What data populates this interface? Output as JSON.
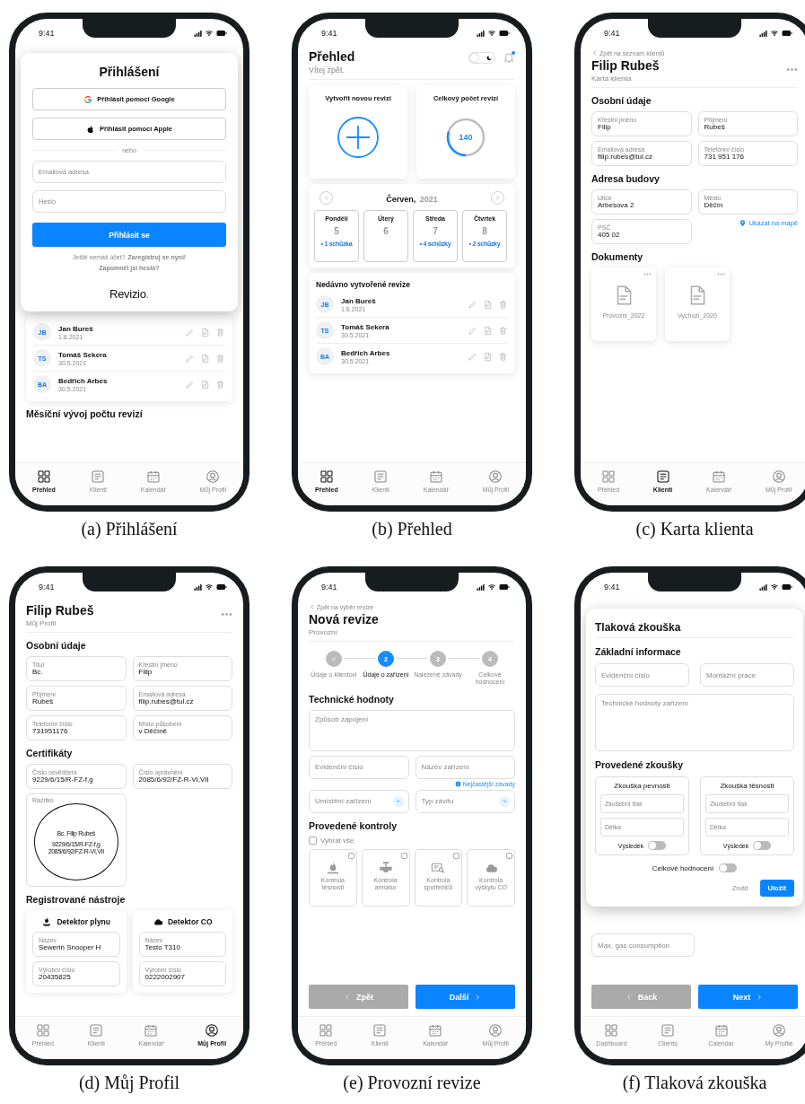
{
  "figures": [
    {
      "caption": "(a) Přihlášení",
      "time": "9:41",
      "screen": {
        "kind": "login",
        "background": {
          "rows": [
            {
              "initials": "JB",
              "name": "Jan Bureš",
              "date": "1.6.2021"
            },
            {
              "initials": "TS",
              "name": "Tomáš Sekera",
              "date": "30.5.2021"
            },
            {
              "initials": "BA",
              "name": "Bedřich Arbes",
              "date": "30.5.2021"
            }
          ],
          "heading": "Měsíční vývoj počtu revizí",
          "nav": [
            {
              "kind": "dashboard",
              "label": "Přehled",
              "selected": true
            },
            {
              "kind": "clients",
              "label": "Klienti",
              "selected": false
            },
            {
              "kind": "calendar",
              "label": "Kalendář",
              "selected": false
            },
            {
              "kind": "profile",
              "label": "Můj Profil",
              "selected": false
            }
          ]
        },
        "title": "Přihlášení",
        "providers": [
          {
            "kind": "google",
            "label": "Přihlásit pomocí Google"
          },
          {
            "kind": "apple",
            "label": "Přihlásit pomocí Apple"
          }
        ],
        "divider": "nebo",
        "fields": [
          {
            "placeholder": "Emailová adresa"
          },
          {
            "placeholder": "Heslo"
          }
        ],
        "submit": "Přihlásit se",
        "register_prompt": "Ještě nemáš účet?",
        "register_link": "Zaregistruj se nyní!",
        "forgot": "Zapomněl jsi heslo?",
        "logo": {
          "name": "Revizio",
          "dot": "."
        }
      }
    },
    {
      "caption": "(b) Přehled",
      "time": "9:41",
      "screen": {
        "kind": "dashboard",
        "title": "Přehled",
        "subtitle": "Vítej zpět.",
        "dark_mode": false,
        "notification": true,
        "cards": [
          {
            "kind": "create",
            "title": "Vytvořit novou revizi"
          },
          {
            "kind": "total",
            "title": "Celkový počet revizí",
            "value": "140",
            "level": 0.3
          }
        ],
        "calendar": {
          "month": "Červen,",
          "year": "2021",
          "days": [
            {
              "name": "Pondělí",
              "number": "5",
              "meetings": "• 1 schůzka"
            },
            {
              "name": "Úterý",
              "number": "6"
            },
            {
              "name": "Středa",
              "number": "7",
              "meetings": "• 4 schůzky"
            },
            {
              "name": "Čtvrtek",
              "number": "8",
              "meetings": "• 2 schůzky"
            }
          ]
        },
        "recent": {
          "title": "Nedávno vytvořené revize",
          "rows": [
            {
              "initials": "JB",
              "name": "Jan Bureš",
              "date": "1.6.2021"
            },
            {
              "initials": "TS",
              "name": "Tomáš Sekera",
              "date": "30.5.2021"
            },
            {
              "initials": "BA",
              "name": "Bedřich Arbes",
              "date": "30.5.2021"
            }
          ]
        },
        "nav": [
          {
            "kind": "dashboard",
            "label": "Přehled",
            "selected": true
          },
          {
            "kind": "clients",
            "label": "Klienti",
            "selected": false
          },
          {
            "kind": "calendar",
            "label": "Kalendář",
            "selected": false
          },
          {
            "kind": "profile",
            "label": "Můj Profil",
            "selected": false
          }
        ]
      }
    },
    {
      "caption": "(c) Karta klienta",
      "time": "9:41",
      "screen": {
        "kind": "form",
        "back": "Zpět na seznam klientů",
        "title": "Filip Rubeš",
        "subtitle": "Karta klienta",
        "more": true,
        "sections": [
          {
            "heading": "Osobní údaje",
            "items": [
              {
                "kind": "field",
                "label": "Křestní jméno",
                "value": "Filip"
              },
              {
                "kind": "field",
                "label": "Příjmení",
                "value": "Rubeš"
              },
              {
                "kind": "field",
                "label": "Emailová adresa",
                "value": "filip.rubes@tul.cz"
              },
              {
                "kind": "field",
                "label": "Telefonní číslo",
                "value": "731 951 176"
              }
            ]
          },
          {
            "heading": "Adresa budovy",
            "items": [
              {
                "kind": "field",
                "label": "Ulice",
                "value": "Arbesova 2"
              },
              {
                "kind": "field",
                "label": "Město",
                "value": "Děčín"
              },
              {
                "kind": "field",
                "label": "PSČ",
                "value": "405 02"
              },
              {
                "kind": "map_link",
                "text": "Ukázat na mapě"
              }
            ]
          },
          {
            "heading": "Dokumenty",
            "items": [
              {
                "kind": "documents",
                "items": [
                  {
                    "name": "Provozni_2022"
                  },
                  {
                    "name": "Vychozi_2020"
                  }
                ]
              }
            ]
          }
        ],
        "nav": [
          {
            "kind": "dashboard",
            "label": "Přehled",
            "selected": false
          },
          {
            "kind": "clients",
            "label": "Klienti",
            "selected": true
          },
          {
            "kind": "calendar",
            "label": "Kalendář",
            "selected": false
          },
          {
            "kind": "profile",
            "label": "Můj Profil",
            "selected": false
          }
        ]
      }
    },
    {
      "caption": "(d) Můj Profil",
      "time": "9:41",
      "screen": {
        "kind": "form",
        "title": "Filip Rubeš",
        "subtitle": "Můj Profil",
        "more": true,
        "sections": [
          {
            "heading": "Osobní údaje",
            "items": [
              {
                "kind": "field",
                "label": "Titul",
                "value": "Bc."
              },
              {
                "kind": "field",
                "label": "Křestní jméno",
                "value": "Filip"
              },
              {
                "kind": "field",
                "label": "Příjmení",
                "value": "Rubeš"
              },
              {
                "kind": "field",
                "label": "Emailová adresa",
                "value": "filip.rubes@tul.cz"
              },
              {
                "kind": "field",
                "label": "Telefonní číslo",
                "value": "731951176"
              },
              {
                "kind": "field",
                "label": "Místo působení",
                "value": "v Děčíně"
              }
            ]
          },
          {
            "heading": "Certifikáty",
            "items": [
              {
                "kind": "field",
                "label": "Číslo osvědčení",
                "value": "9229/6/15/R-FZ-f,g"
              },
              {
                "kind": "field",
                "label": "Číslo oprávnění",
                "value": "2085/6/92/FZ-R-VI,VII"
              },
              {
                "kind": "stamp",
                "label": "Razítko",
                "lines": [
                  "Bc. Filip Rubeš",
                  "9229/6/15/R-FZ-f,g",
                  "2085/6/92/FZ-R-VI,VII"
                ]
              }
            ]
          },
          {
            "heading": "Registrované nástroje",
            "items": [
              {
                "kind": "gas_tool",
                "title": "Detektor plynu",
                "fields": [
                  {
                    "kind": "field",
                    "label": "Název",
                    "value": "Sewerin Snooper H"
                  },
                  {
                    "kind": "field",
                    "label": "Výrobní číslo",
                    "value": "20435825"
                  }
                ]
              },
              {
                "kind": "co_tool",
                "title": "Detektor CO",
                "fields": [
                  {
                    "kind": "field",
                    "label": "Název",
                    "value": "Testo T310"
                  },
                  {
                    "kind": "field",
                    "label": "Výrobní číslo",
                    "value": "0222002907"
                  }
                ]
              }
            ]
          }
        ],
        "nav": [
          {
            "kind": "dashboard",
            "label": "Přehled",
            "selected": false
          },
          {
            "kind": "clients",
            "label": "Klienti",
            "selected": false
          },
          {
            "kind": "calendar",
            "label": "Kalendář",
            "selected": false
          },
          {
            "kind": "profile",
            "label": "Můj Profil",
            "selected": true
          }
        ]
      }
    },
    {
      "caption": "(e) Provozní revize",
      "time": "9:41",
      "screen": {
        "kind": "form",
        "back": "Zpět na výběr revize",
        "title": "Nová revize",
        "subtitle": "Provozní",
        "steps": [
          {
            "label": "Údaje o klientovi",
            "done": true,
            "selected": false
          },
          {
            "number": "2",
            "label": "Údaje o zařízení",
            "done": false,
            "selected": true
          },
          {
            "number": "3",
            "label": "Nalezené závady",
            "done": false,
            "selected": false
          },
          {
            "number": "4",
            "label": "Celkové hodnocení",
            "done": false,
            "selected": false
          }
        ],
        "sections": [
          {
            "heading": "Technické hodnoty",
            "items": [
              {
                "kind": "textarea",
                "placeholder": "Způsob zapojení"
              },
              {
                "kind": "input",
                "placeholder": "Evidenční číslo"
              },
              {
                "kind": "input",
                "placeholder": "Název zařízení"
              },
              {
                "kind": "hint",
                "text": "Nejčastější závady"
              },
              {
                "kind": "select",
                "placeholder": "Umístění zařízení"
              },
              {
                "kind": "select",
                "placeholder": "Typ závitu"
              }
            ]
          },
          {
            "heading": "Provedené kontroly",
            "items": [
              {
                "kind": "checkbox",
                "label": "Vybrat vše",
                "checked": false
              },
              {
                "kind": "tiles",
                "items": [
                  {
                    "kind": "flame",
                    "label": "Kontrola těsnosti",
                    "checked": false
                  },
                  {
                    "kind": "valve",
                    "label": "Kontrola armatur",
                    "checked": false
                  },
                  {
                    "kind": "appliance",
                    "label": "Kontrola spotřebičů",
                    "checked": false
                  },
                  {
                    "kind": "co",
                    "label": "Kontrola výskytu CO",
                    "checked": false
                  }
                ]
              }
            ]
          }
        ],
        "footer": {
          "back": {
            "label": "Zpět",
            "disabled": true
          },
          "next": {
            "label": "Další",
            "disabled": false
          }
        },
        "nav": [
          {
            "kind": "dashboard",
            "label": "Přehled",
            "selected": false
          },
          {
            "kind": "clients",
            "label": "Klienti",
            "selected": false
          },
          {
            "kind": "calendar",
            "label": "Kalendář",
            "selected": false
          },
          {
            "kind": "profile",
            "label": "Můj Profil",
            "selected": false
          }
        ]
      }
    },
    {
      "caption": "(f) Tlaková zkouška",
      "time": "9:41",
      "screen": {
        "kind": "modal_form",
        "background": {
          "fields": [
            {
              "placeholder": "Max. gas consumption"
            }
          ],
          "back": "Back",
          "next": "Next",
          "nav": [
            {
              "kind": "dashboard",
              "label": "Dashboard",
              "selected": false
            },
            {
              "kind": "clients",
              "label": "Clients",
              "selected": false
            },
            {
              "kind": "calendar",
              "label": "Calendar",
              "selected": false
            },
            {
              "kind": "profile",
              "label": "My Profile",
              "selected": false
            }
          ]
        },
        "title": "Tlaková zkouška",
        "sections": [
          {
            "heading": "Základní informace",
            "items": [
              {
                "kind": "input",
                "placeholder": "Evidenční číslo"
              },
              {
                "kind": "input",
                "placeholder": "Montážní práce"
              },
              {
                "kind": "textarea",
                "placeholder": "Technické hodnoty zařízení"
              }
            ]
          },
          {
            "heading": "Provedené zkoušky",
            "items": [
              {
                "kind": "test",
                "title": "Zkouška pevnosti",
                "fields": [
                  {
                    "placeholder": "Zkušební tlak"
                  },
                  {
                    "placeholder": "Délka"
                  }
                ],
                "result_label": "Výsledek",
                "result": false
              },
              {
                "kind": "test",
                "title": "Zkouška těsnosti",
                "fields": [
                  {
                    "placeholder": "Zkušební tlak"
                  },
                  {
                    "placeholder": "Délka"
                  }
                ],
                "result_label": "Výsledek",
                "result": false
              },
              {
                "kind": "toggle",
                "label": "Celkové hodnocení",
                "on": false
              },
              {
                "kind": "actions",
                "cancel": "Zrušit",
                "save": "Uložit"
              }
            ]
          }
        ]
      }
    }
  ]
}
